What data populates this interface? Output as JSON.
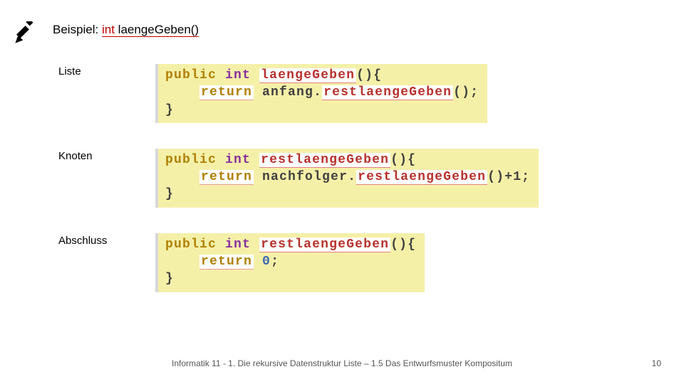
{
  "title": {
    "prefix": "Beispiel: ",
    "kw": "int",
    "method": " laengeGeben()"
  },
  "rows": {
    "liste": {
      "label": "Liste",
      "code": {
        "l1a": "public",
        "l1b": "int",
        "l1c": "laengeGeben",
        "l1d": "(){",
        "l2a": "return",
        "l2b": "anfang.",
        "l2c": "restlaengeGeben",
        "l2d": "();",
        "l3": "}"
      }
    },
    "knoten": {
      "label": "Knoten",
      "code": {
        "l1a": "public",
        "l1b": "int",
        "l1c": "restlaengeGeben",
        "l1d": "(){",
        "l2a": "return",
        "l2b": "nachfolger.",
        "l2c": "restlaengeGeben",
        "l2d": "()+1;",
        "l3": "}"
      }
    },
    "abschluss": {
      "label": "Abschluss",
      "code": {
        "l1a": "public",
        "l1b": "int",
        "l1c": "restlaengeGeben",
        "l1d": "(){",
        "l2a": "return",
        "l2b": "0",
        "l2c": ";",
        "l3": "}"
      }
    }
  },
  "footer": "Informatik 11 - 1. Die rekursive Datenstruktur Liste – 1.5 Das Entwurfsmuster Kompositum",
  "page": "10"
}
